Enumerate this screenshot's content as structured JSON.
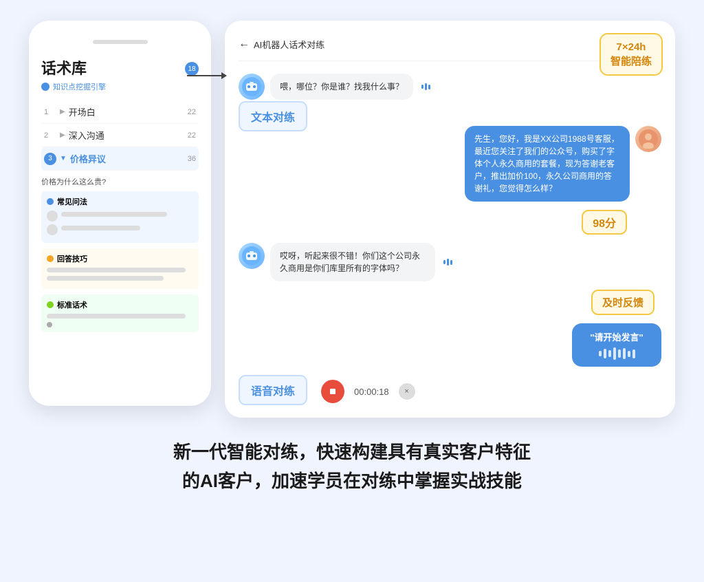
{
  "page": {
    "background": "#f0f4ff"
  },
  "phone": {
    "title": "话术库",
    "subtitle": "知识点挖掘引擎",
    "badge": "18",
    "menu_items": [
      {
        "num": "1",
        "label": "开场白",
        "count": "22",
        "active": false
      },
      {
        "num": "2",
        "label": "深入沟通",
        "count": "22",
        "active": false
      },
      {
        "num": "3",
        "label": "价格异议",
        "count": "36",
        "active": true
      }
    ],
    "question": "价格为什么这么贵?",
    "sections": [
      {
        "id": "faq",
        "label": "常见问法",
        "color": "blue"
      },
      {
        "id": "tips",
        "label": "回答技巧",
        "color": "orange"
      },
      {
        "id": "standard",
        "label": "标准话术",
        "color": "green"
      }
    ]
  },
  "chat": {
    "header_title": "AI机器人话术对练",
    "messages": [
      {
        "role": "bot",
        "text": "喂，哪位？你是谁？找我什么事？"
      },
      {
        "role": "human",
        "text": "先生，您好，我是XX公司1988号客服，最近您关注了我们的公众号，购买了字体个人永久商用的套餐，现为答谢老客户，推出加价100，永久公司商用的答谢礼，您觉得怎么样？"
      },
      {
        "role": "bot",
        "text": "哎呀，听起来很不错！你们这个公司永久商用是你们库里所有的字体吗？"
      },
      {
        "role": "voice",
        "text": "\"请开始发言\""
      }
    ],
    "text_practice_label": "文本对练",
    "voice_practice_label": "语音对练",
    "score": "98分",
    "feedback": "及时反馈",
    "badge_7x24": "7×24h\n智能陪练",
    "timer": "00:00:18",
    "close": "×"
  },
  "bottom": {
    "text_line1": "新一代智能对练，快速构建具有真实客户特征",
    "text_line2": "的AI客户，加速学员在对练中掌握实战技能"
  }
}
